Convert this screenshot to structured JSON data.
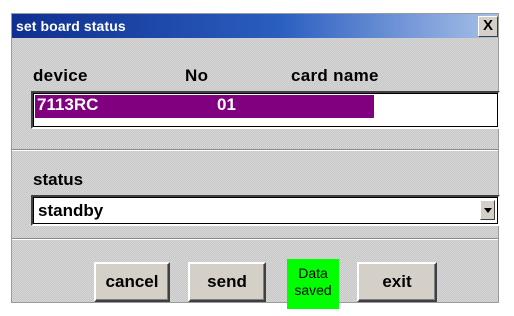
{
  "window": {
    "title": "set board status",
    "close_glyph": "X"
  },
  "board_list": {
    "headers": {
      "device": "device",
      "no": "No",
      "card_name": "card name"
    },
    "rows": [
      {
        "device": "7113RC",
        "no": "01",
        "card_name": "",
        "selected": true
      }
    ]
  },
  "status": {
    "label": "status",
    "selected_value": "standby"
  },
  "buttons": {
    "cancel": "cancel",
    "send": "send",
    "exit": "exit"
  },
  "indicator": {
    "line1": "Data",
    "line2": "saved",
    "color": "#00ff00"
  },
  "colors": {
    "title_bar": "#0f2f8f",
    "selection": "#800080"
  },
  "icons": {
    "close": "close-icon",
    "dropdown": "chevron-down-icon"
  }
}
